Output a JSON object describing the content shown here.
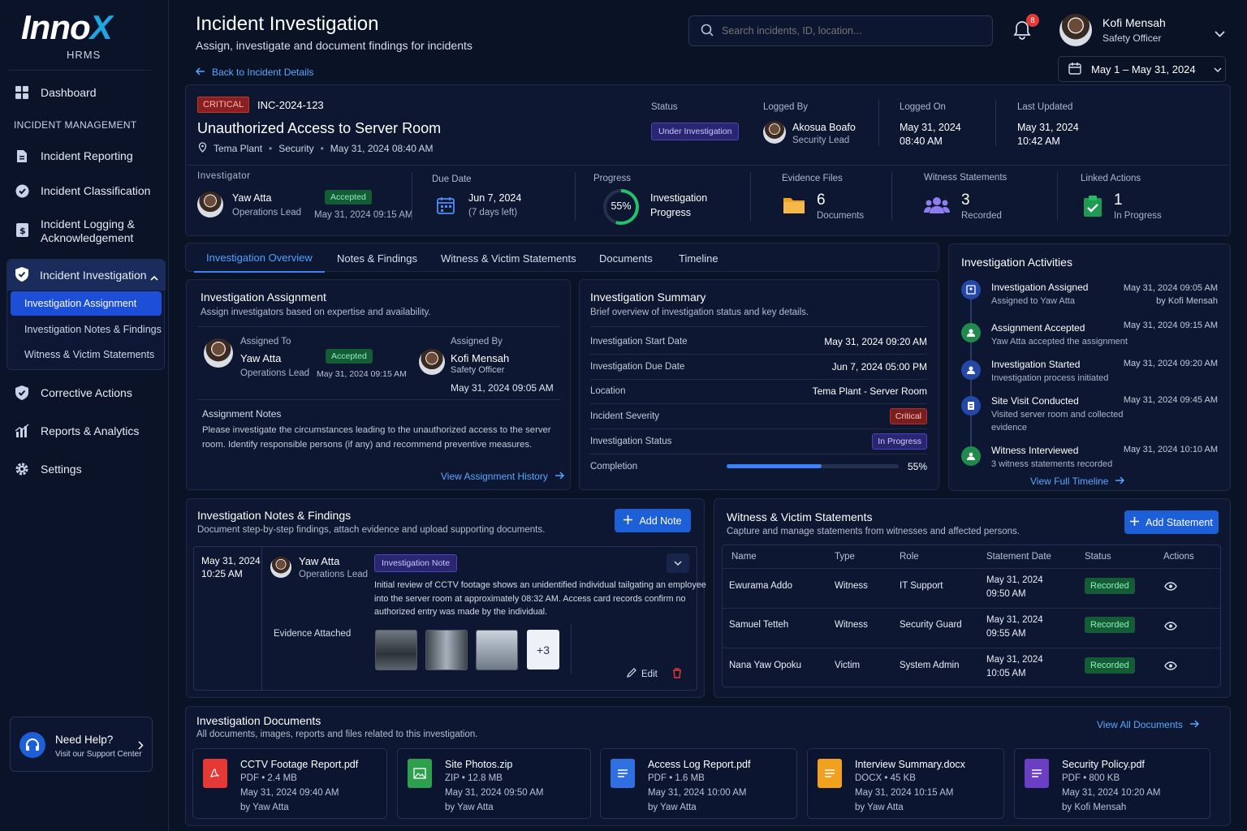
{
  "brand": {
    "logo_main": "Inno",
    "logo_x": "X",
    "logo_sub": "HRMS"
  },
  "sidebar": {
    "dashboard": "Dashboard",
    "section": "INCIDENT MANAGEMENT",
    "items": [
      "Incident Reporting",
      "Incident Classification",
      "Incident Logging &",
      "Acknowledgement"
    ],
    "group_title": "Incident Investigation",
    "sub": [
      "Investigation Assignment",
      "Investigation Notes & Findings",
      "Witness & Victim Statements"
    ],
    "bottom": [
      "Corrective Actions",
      "Reports & Analytics",
      "Settings"
    ],
    "help_title": "Need Help?",
    "help_sub": "Visit our Support Center"
  },
  "header": {
    "title": "Incident Investigation",
    "subtitle": "Assign, investigate and document findings for incidents",
    "back": "Back to Incident Details",
    "search_placeholder": "Search incidents, ID, location...",
    "notif_count": "8",
    "user_name": "Kofi Mensah",
    "user_role": "Safety Officer",
    "date_range": "May 1 – May 31, 2024"
  },
  "incident": {
    "severity": "CRITICAL",
    "id": "INC-2024-123",
    "title": "Unauthorized Access to Server Room",
    "location": "Tema Plant",
    "category": "Security",
    "datetime": "May 31, 2024 08:40 AM",
    "status_label": "Status",
    "status": "Under Investigation",
    "logged_by_label": "Logged By",
    "logged_by": "Akosua Boafo",
    "logged_by_role": "Security Lead",
    "logged_on_label": "Logged On",
    "logged_on_date": "May 31, 2024",
    "logged_on_time": "08:40 AM",
    "updated_label": "Last Updated",
    "updated_date": "May 31, 2024",
    "updated_time": "10:42 AM"
  },
  "stats": {
    "investigator_label": "Investigator",
    "investigator": "Yaw Atta",
    "investigator_role": "Operations Lead",
    "accepted": "Accepted",
    "accepted_at": "May 31, 2024 09:15 AM",
    "due_label": "Due Date",
    "due": "Jun 7, 2024",
    "due_left": "(7 days left)",
    "progress_label": "Progress",
    "progress_pct": "55%",
    "progress_value": 0.55,
    "progress_t1": "Investigation",
    "progress_t2": "Progress",
    "evidence_label": "Evidence Files",
    "evidence": "6",
    "evidence_sub": "Documents",
    "witness_label": "Witness Statements",
    "witness": "3",
    "witness_sub": "Recorded",
    "linked_label": "Linked Actions",
    "linked": "1",
    "linked_sub": "In Progress"
  },
  "tabs": [
    "Investigation Overview",
    "Notes & Findings",
    "Witness & Victim Statements",
    "Documents",
    "Timeline"
  ],
  "assignment": {
    "title": "Investigation Assignment",
    "subtitle": "Assign investigators based on expertise and availability.",
    "assigned_to_label": "Assigned To",
    "assigned_to": "Yaw Atta",
    "assigned_to_role": "Operations Lead",
    "accepted": "Accepted",
    "accepted_at": "May 31, 2024 09:15 AM",
    "assigned_by_label": "Assigned By",
    "assigned_by": "Kofi Mensah",
    "assigned_by_role": "Safety Officer",
    "assigned_by_at": "May 31, 2024 09:05 AM",
    "notes_label": "Assignment Notes",
    "notes_1": "Please investigate the circumstances leading to the unauthorized access to the server",
    "notes_2": "room. Identify responsible persons (if any) and recommend preventive measures.",
    "history": "View Assignment History"
  },
  "summary": {
    "title": "Investigation Summary",
    "subtitle": "Brief overview of investigation status and key details.",
    "rows": [
      {
        "k": "Investigation Start Date",
        "v": "May 31, 2024 09:20 AM"
      },
      {
        "k": "Investigation Due Date",
        "v": "Jun 7, 2024 05:00 PM"
      },
      {
        "k": "Location",
        "v": "Tema Plant - Server Room"
      },
      {
        "k": "Incident Severity",
        "v": "Critical"
      },
      {
        "k": "Investigation Status",
        "v": "In Progress"
      },
      {
        "k": "Completion",
        "v": "55%"
      }
    ],
    "completion_value": 0.55
  },
  "activities": {
    "title": "Investigation Activities",
    "items": [
      {
        "t": "Investigation Assigned",
        "s": "Assigned to Yaw Atta",
        "d": "May 31, 2024 09:05 AM",
        "d2": "by Kofi Mensah"
      },
      {
        "t": "Assignment Accepted",
        "s": "Yaw Atta accepted the assignment",
        "d": "May 31, 2024 09:15 AM"
      },
      {
        "t": "Investigation Started",
        "s": "Investigation process initiated",
        "d": "May 31, 2024 09:20 AM"
      },
      {
        "t": "Site Visit Conducted",
        "s": "Visited server room and collected",
        "s2": "evidence",
        "d": "May 31, 2024 09:45 AM"
      },
      {
        "t": "Witness Interviewed",
        "s": "3 witness statements recorded",
        "d": "May 31, 2024 10:10 AM"
      }
    ],
    "full": "View Full Timeline"
  },
  "notes": {
    "title": "Investigation Notes & Findings",
    "subtitle": "Document step-by-step findings, attach evidence and upload supporting documents.",
    "add": "Add Note",
    "date": "May 31, 2024",
    "time": "10:25 AM",
    "author": "Yaw Atta",
    "role": "Operations Lead",
    "tag": "Investigation Note",
    "text_1": "Initial review of CCTV footage shows an unidentified individual tailgating an employee",
    "text_2": "into the server room at approximately 08:32 AM. Access card records confirm no",
    "text_3": "authorized entry was made by the individual.",
    "evidence": "Evidence Attached",
    "more": "+3",
    "edit": "Edit"
  },
  "statements": {
    "title": "Witness & Victim Statements",
    "subtitle": "Capture and manage statements from witnesses and affected persons.",
    "add": "Add Statement",
    "headers": [
      "Name",
      "Type",
      "Role",
      "Statement Date",
      "Status",
      "Actions"
    ],
    "rows": [
      {
        "name": "Ewurama Addo",
        "type": "Witness",
        "role": "IT Support",
        "date": "May 31, 2024",
        "time": "09:50 AM",
        "status": "Recorded"
      },
      {
        "name": "Samuel Tetteh",
        "type": "Witness",
        "role": "Security Guard",
        "date": "May 31, 2024",
        "time": "09:55 AM",
        "status": "Recorded"
      },
      {
        "name": "Nana Yaw Opoku",
        "type": "Victim",
        "role": "System Admin",
        "date": "May 31, 2024",
        "time": "10:05 AM",
        "status": "Recorded"
      }
    ]
  },
  "documents": {
    "title": "Investigation Documents",
    "subtitle": "All documents, images, reports and files related to this investigation.",
    "view_all": "View All Documents",
    "items": [
      {
        "name": "CCTV Footage Report.pdf",
        "meta": "PDF • 2.4 MB",
        "date": "May 31, 2024 09:40 AM",
        "by": "by Yaw Atta",
        "color": "#e53935",
        "icon": "pdf-icon"
      },
      {
        "name": "Site Photos.zip",
        "meta": "ZIP • 12.8 MB",
        "date": "May 31, 2024 09:50 AM",
        "by": "by Yaw Atta",
        "color": "#2e9e4f",
        "icon": "image-icon"
      },
      {
        "name": "Access Log Report.pdf",
        "meta": "PDF • 1.6 MB",
        "date": "May 31, 2024 10:00 AM",
        "by": "by Yaw Atta",
        "color": "#2f6fe0",
        "icon": "doc-icon"
      },
      {
        "name": "Interview Summary.docx",
        "meta": "DOCX • 45 KB",
        "date": "May 31, 2024 10:15 AM",
        "by": "by Yaw Atta",
        "color": "#f2a11f",
        "icon": "doc-icon"
      },
      {
        "name": "Security Policy.pdf",
        "meta": "PDF • 800 KB",
        "date": "May 31, 2024 10:20 AM",
        "by": "by Kofi Mensah",
        "color": "#6a3fc4",
        "icon": "doc-icon"
      }
    ]
  }
}
